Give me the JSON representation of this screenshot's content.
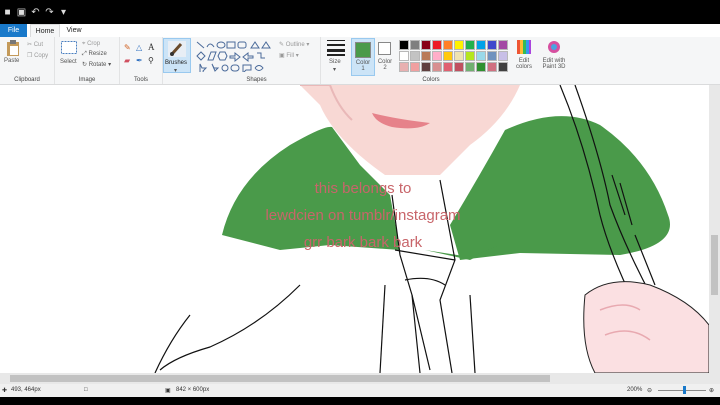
{
  "tabs": {
    "file": "File",
    "home": "Home",
    "view": "View"
  },
  "ribbon": {
    "clipboard": {
      "paste": "Paste",
      "cut": "Cut",
      "copy": "Copy",
      "label": "Clipboard"
    },
    "image": {
      "select": "Select",
      "crop": "Crop",
      "resize": "Resize",
      "rotate": "Rotate",
      "label": "Image"
    },
    "tools": {
      "label": "Tools"
    },
    "brushes": {
      "label": "Brushes"
    },
    "shapes": {
      "outline": "Outline",
      "fill": "Fill",
      "label": "Shapes"
    },
    "size": {
      "label": "Size"
    },
    "color1": {
      "label": "Color 1",
      "color": "#4a9a4a"
    },
    "color2": {
      "label": "Color 2",
      "color": "#ffffff"
    },
    "colors": {
      "label": "Colors"
    },
    "edit_colors": "Edit colors",
    "edit_paint3d": "Edit with Paint 3D"
  },
  "palette": [
    "#000000",
    "#7f7f7f",
    "#880015",
    "#ed1c24",
    "#ff7f27",
    "#fff200",
    "#22b14c",
    "#00a2e8",
    "#3f48cc",
    "#a349a4",
    "#ffffff",
    "#c3c3c3",
    "#b97a57",
    "#ffaec9",
    "#ffc90e",
    "#efe4b0",
    "#b5e61d",
    "#99d9ea",
    "#7092be",
    "#c8bfe7",
    "#e8b0b0",
    "#f0a0a0",
    "#604040",
    "#d89090",
    "#e06070",
    "#c05060",
    "#70b070",
    "#309030",
    "#d07080",
    "#404040"
  ],
  "overlay": {
    "line1": "this belongs to",
    "line2": "lewdcien on tumblr/instagram",
    "line3": "grr bark bark bark"
  },
  "status": {
    "cursor": "493, 464px",
    "dimensions": "842 × 600px",
    "zoom": "200%"
  }
}
